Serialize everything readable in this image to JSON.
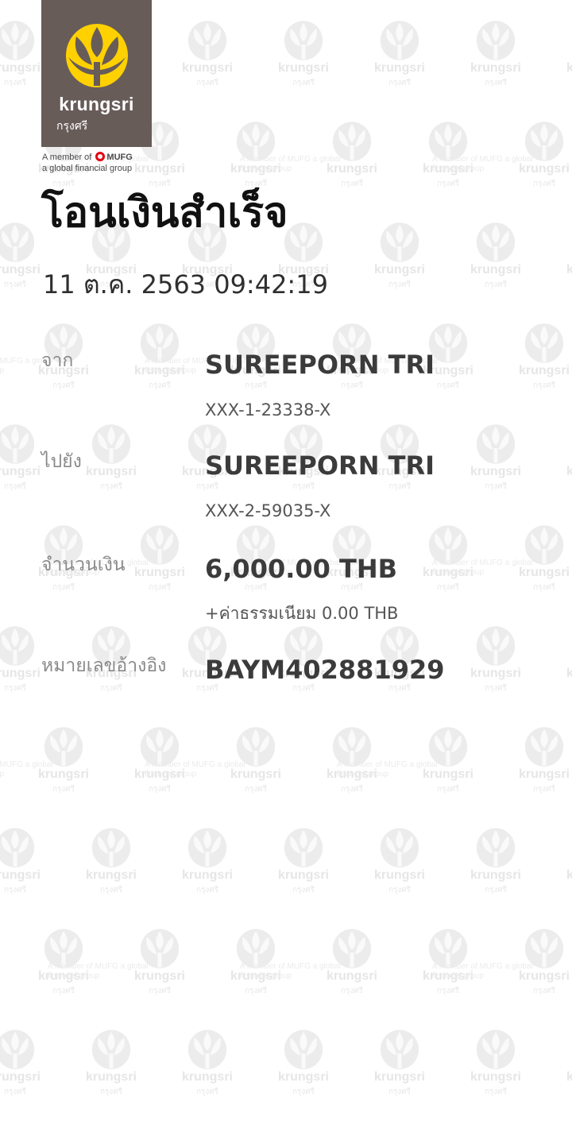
{
  "logo": {
    "icon": "krungsri-logo-icon",
    "name": "krungsri",
    "thai_name": "กรุงศรี",
    "member_prefix": "A member of",
    "member_brand": "MUFG",
    "member_tagline": "a global financial group",
    "brand_bg": "#685c59",
    "brand_yellow": "#ffd100",
    "mufg_red": "#e60012"
  },
  "title": "โอนเงินสำเร็จ",
  "datetime": "11 ต.ค. 2563 09:42:19",
  "transfer": {
    "from": {
      "label": "จาก",
      "name": "SUREEPORN TRI",
      "account": "XXX-1-23338-X"
    },
    "to": {
      "label": "ไปยัง",
      "name": "SUREEPORN TRI",
      "account": "XXX-2-59035-X"
    },
    "amount": {
      "label": "จำนวนเงิน",
      "value": "6,000.00 THB",
      "fee": "+ค่าธรรมเนียม 0.00 THB"
    },
    "reference": {
      "label": "หมายเลขอ้างอิง",
      "value": "BAYM402881929"
    }
  }
}
